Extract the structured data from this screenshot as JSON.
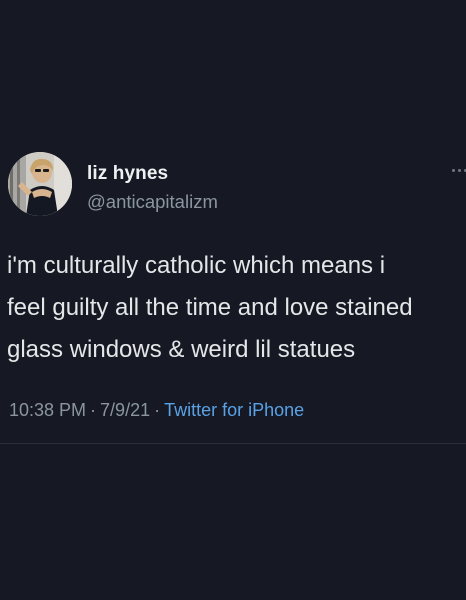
{
  "author": {
    "display_name": "liz hynes",
    "handle": "@anticapitalizm",
    "avatar_icon": "profile-photo"
  },
  "tweet": {
    "lines": [
      "i'm culturally catholic which means i",
      "feel guilty all the time and love stained",
      "glass windows & weird lil statues"
    ]
  },
  "meta": {
    "time": "10:38 PM",
    "separator": "·",
    "date": "7/9/21",
    "source": "Twitter for iPhone"
  },
  "actions": {
    "more_icon": "more-dots-icon"
  },
  "colors": {
    "background": "#161923",
    "primary_text": "#e7e9ea",
    "secondary_text": "#8b95a0",
    "link": "#5aa1e6"
  }
}
